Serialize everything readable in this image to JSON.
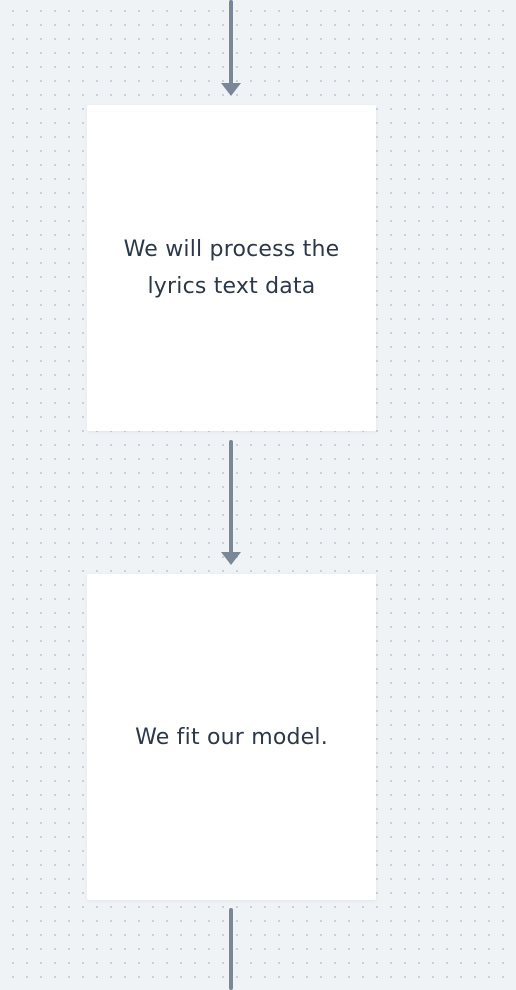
{
  "colors": {
    "background": "#eff3f6",
    "grid_dot": "#c3cbd3",
    "connector": "#7a8796",
    "node_fill": "#ffffff",
    "node_text": "#2c3848"
  },
  "nodes": [
    {
      "text": "We will process the lyrics text data"
    },
    {
      "text": "We fit our model."
    }
  ],
  "connectors": [
    {
      "from": "previous-step",
      "to": "node-1",
      "arrowhead": true
    },
    {
      "from": "node-1",
      "to": "node-2",
      "arrowhead": true
    },
    {
      "from": "node-2",
      "to": "next-step",
      "arrowhead": false
    }
  ]
}
